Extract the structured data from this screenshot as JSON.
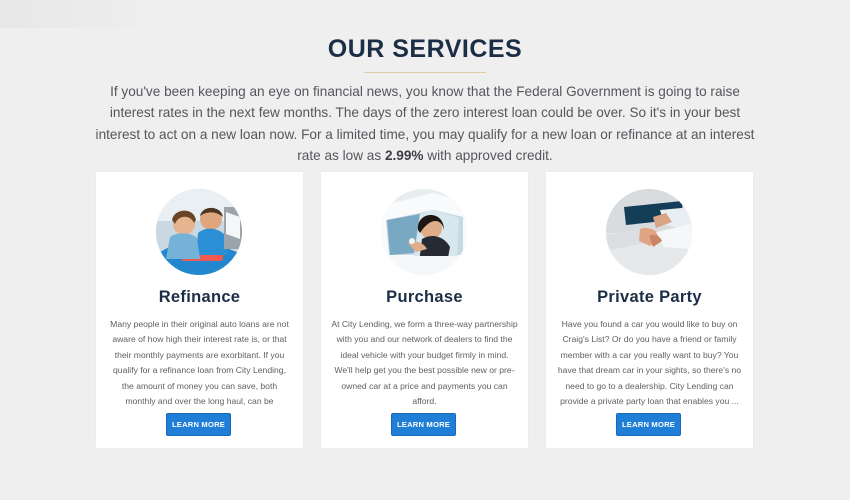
{
  "services": {
    "title": "OUR SERVICES",
    "intro_text": "If you've been keeping an eye on financial news, you know that the Federal Government is going to raise interest rates in the next few months. The days of the zero interest loan could be over. So it's in your best interest to act on a new loan now. For a limited time, you may qualify for a new loan or refinance at an interest rate as low as ",
    "intro_rate": "2.99%",
    "intro_suffix": " with approved credit.",
    "cards": [
      {
        "title": "Refinance",
        "text": "Many people in their original auto loans are not aware of how high their interest rate is, or that their monthly payments are exorbitant. If you qualify for a refinance loan from City Lending, the amount of money you can save, both monthly and over the long haul, can be staggering.",
        "button": "LEARN MORE",
        "image": "two-people-reviewing-document-image"
      },
      {
        "title": "Purchase",
        "text": "At City Lending, we form a three-way partnership with you and our network of dealers to find the ideal vehicle with your budget firmly in mind. We'll help get you the best possible new or pre-owned car at a price and payments you can afford.",
        "button": "LEARN MORE",
        "image": "woman-in-car-window-image"
      },
      {
        "title": "Private Party",
        "text": "Have you found a car you would like to buy on Craig's List? Or do you have a friend or family member with a car you really want to buy? You have that dream car in your sights, so there's no need to go to a dealership. City Lending can provide a private party loan that enables you ...",
        "button": "LEARN MORE",
        "image": "handshake-with-folder-image"
      }
    ]
  },
  "colors": {
    "background": "#efeff0",
    "heading": "#1c2d46",
    "button": "#1f7fd6",
    "card": "#ffffff"
  }
}
